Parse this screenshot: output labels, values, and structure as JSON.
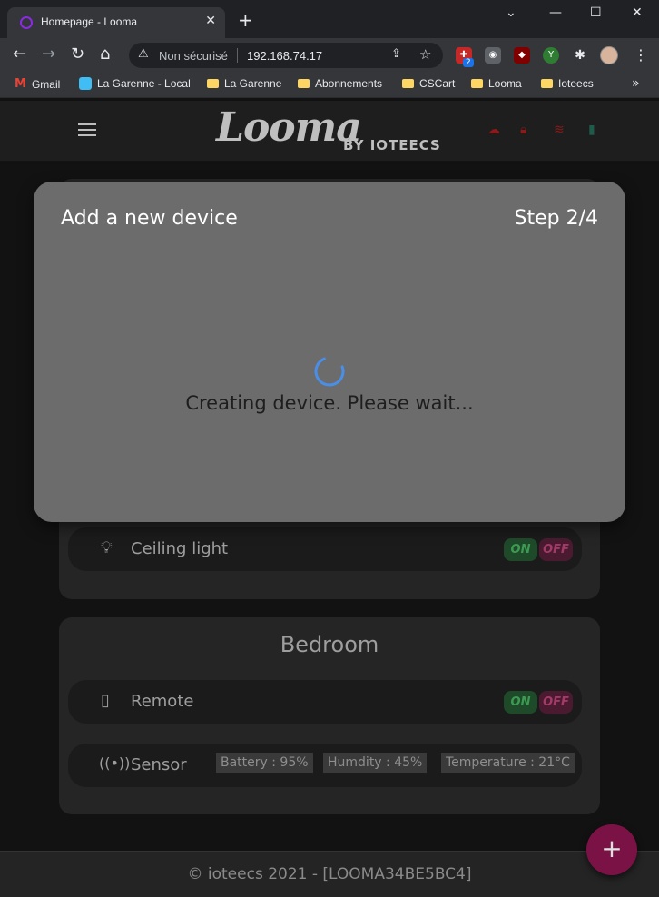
{
  "browser": {
    "tab_title": "Homepage - Looma",
    "security_label": "Non sécurisé",
    "url": "192.168.74.17",
    "extension_badge": "2",
    "bookmarks": [
      {
        "label": "Gmail",
        "icon": "gmail-icon"
      },
      {
        "label": "La Garenne - Local",
        "icon": "home-assistant-icon"
      },
      {
        "label": "La Garenne",
        "icon": "folder-icon"
      },
      {
        "label": "Abonnements",
        "icon": "folder-icon"
      },
      {
        "label": "CSCart",
        "icon": "folder-icon"
      },
      {
        "label": "Looma",
        "icon": "folder-icon"
      },
      {
        "label": "Ioteecs",
        "icon": "folder-icon"
      }
    ]
  },
  "app": {
    "logo": "Looma",
    "logo_by": "BY IOTEECS",
    "rooms": [
      {
        "title": "",
        "devices": [
          {
            "icon": "bulb-icon",
            "label": "Ceiling light",
            "on_label": "ON",
            "off_label": "OFF"
          }
        ]
      },
      {
        "title": "Bedroom",
        "devices": [
          {
            "icon": "remote-icon",
            "label": "Remote",
            "on_label": "ON",
            "off_label": "OFF"
          },
          {
            "icon": "sensor-icon",
            "label": "Sensor",
            "chips": [
              "Battery : 95%",
              "Humdity : 45%",
              "Temperature : 21°C"
            ]
          }
        ]
      }
    ],
    "footer": "© ioteecs 2021 - [LOOMA34BE5BC4]",
    "fab_label": "+"
  },
  "modal": {
    "title": "Add a new device",
    "step": "Step 2/4",
    "message": "Creating device. Please wait..."
  },
  "colors": {
    "modal_bg": "#6c6c6c",
    "fab": "#7a1246",
    "toggle_on": "#3c9a52",
    "toggle_off": "#a33a68",
    "status_red": "#b3261e",
    "spinner": "#4a8fe7"
  }
}
